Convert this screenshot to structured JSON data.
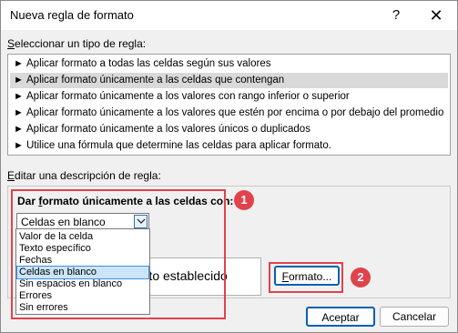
{
  "dialog": {
    "title": "Nueva regla de formato",
    "help_icon": "?",
    "close_icon": "✕"
  },
  "rule_type": {
    "label_pre": "",
    "label_key": "S",
    "label_post": "eleccionar un tipo de regla:",
    "arrow_glyph": "►",
    "items": [
      {
        "label": "Aplicar formato a todas las celdas según sus valores",
        "selected": false
      },
      {
        "label": "Aplicar formato únicamente a las celdas que contengan",
        "selected": true
      },
      {
        "label": "Aplicar formato únicamente a los valores con rango inferior o superior",
        "selected": false
      },
      {
        "label": "Aplicar formato únicamente a los valores que estén por encima o por debajo del promedio",
        "selected": false
      },
      {
        "label": "Aplicar formato únicamente a los valores únicos o duplicados",
        "selected": false
      },
      {
        "label": "Utilice una fórmula que determine las celdas para aplicar formato.",
        "selected": false
      }
    ]
  },
  "description": {
    "label_pre": "",
    "label_key": "E",
    "label_post": "ditar una descripción de regla:",
    "heading_pre": "Dar ",
    "heading_key": "f",
    "heading_post": "ormato únicamente a las celdas con:",
    "combo_value": "Celdas en blanco",
    "dropdown_options": [
      {
        "label": "Valor de la celda",
        "selected": false
      },
      {
        "label": "Texto específico",
        "selected": false
      },
      {
        "label": "Fechas",
        "selected": false
      },
      {
        "label": "Celdas en blanco",
        "selected": true
      },
      {
        "label": "Sin espacios en blanco",
        "selected": false
      },
      {
        "label": "Errores",
        "selected": false
      },
      {
        "label": "Sin errores",
        "selected": false
      }
    ],
    "preview_text": "mato establecido",
    "format_button_key": "F",
    "format_button_rest": "ormato..."
  },
  "buttons": {
    "accept": "Aceptar",
    "cancel": "Cancelar"
  },
  "annotations": {
    "badge_1": "1",
    "badge_2": "2",
    "color": "#e0434b"
  }
}
